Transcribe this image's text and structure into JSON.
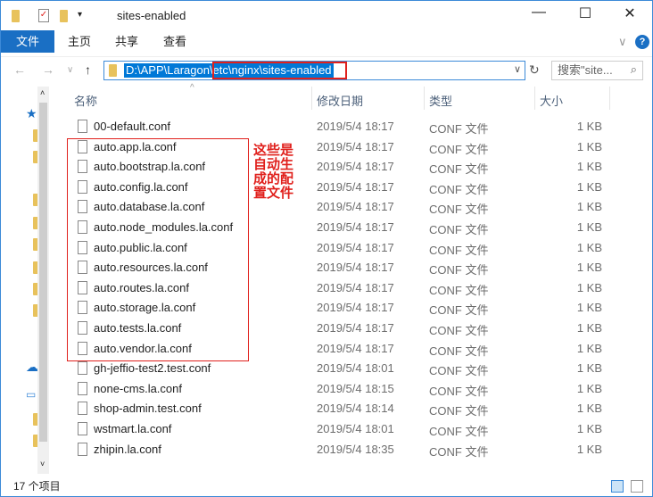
{
  "window": {
    "title": "sites-enabled",
    "minimize": "—",
    "maximize": "☐",
    "close": "✕"
  },
  "ribbon": {
    "tabs": [
      "文件",
      "主页",
      "共享",
      "查看"
    ],
    "help": "?",
    "collapse": "∨"
  },
  "nav": {
    "back": "←",
    "forward": "→",
    "recent": "∨",
    "up": "↑",
    "path": "D:\\APP\\Laragon\\etc\\nginx\\sites-enabled",
    "dropdown": "∨",
    "refresh": "↻",
    "search_placeholder": "搜索\"site...",
    "search_icon": "⌕"
  },
  "columns": {
    "name": "名称",
    "date": "修改日期",
    "type": "类型",
    "size": "大小",
    "sort_indicator": "^"
  },
  "files": [
    {
      "name": "00-default.conf",
      "date": "2019/5/4 18:17",
      "type": "CONF 文件",
      "size": "1 KB"
    },
    {
      "name": "auto.app.la.conf",
      "date": "2019/5/4 18:17",
      "type": "CONF 文件",
      "size": "1 KB"
    },
    {
      "name": "auto.bootstrap.la.conf",
      "date": "2019/5/4 18:17",
      "type": "CONF 文件",
      "size": "1 KB"
    },
    {
      "name": "auto.config.la.conf",
      "date": "2019/5/4 18:17",
      "type": "CONF 文件",
      "size": "1 KB"
    },
    {
      "name": "auto.database.la.conf",
      "date": "2019/5/4 18:17",
      "type": "CONF 文件",
      "size": "1 KB"
    },
    {
      "name": "auto.node_modules.la.conf",
      "date": "2019/5/4 18:17",
      "type": "CONF 文件",
      "size": "1 KB"
    },
    {
      "name": "auto.public.la.conf",
      "date": "2019/5/4 18:17",
      "type": "CONF 文件",
      "size": "1 KB"
    },
    {
      "name": "auto.resources.la.conf",
      "date": "2019/5/4 18:17",
      "type": "CONF 文件",
      "size": "1 KB"
    },
    {
      "name": "auto.routes.la.conf",
      "date": "2019/5/4 18:17",
      "type": "CONF 文件",
      "size": "1 KB"
    },
    {
      "name": "auto.storage.la.conf",
      "date": "2019/5/4 18:17",
      "type": "CONF 文件",
      "size": "1 KB"
    },
    {
      "name": "auto.tests.la.conf",
      "date": "2019/5/4 18:17",
      "type": "CONF 文件",
      "size": "1 KB"
    },
    {
      "name": "auto.vendor.la.conf",
      "date": "2019/5/4 18:17",
      "type": "CONF 文件",
      "size": "1 KB"
    },
    {
      "name": "gh-jeffio-test2.test.conf",
      "date": "2019/5/4 18:01",
      "type": "CONF 文件",
      "size": "1 KB"
    },
    {
      "name": "none-cms.la.conf",
      "date": "2019/5/4 18:15",
      "type": "CONF 文件",
      "size": "1 KB"
    },
    {
      "name": "shop-admin.test.conf",
      "date": "2019/5/4 18:14",
      "type": "CONF 文件",
      "size": "1 KB"
    },
    {
      "name": "wstmart.la.conf",
      "date": "2019/5/4 18:01",
      "type": "CONF 文件",
      "size": "1 KB"
    },
    {
      "name": "zhipin.la.conf",
      "date": "2019/5/4 18:35",
      "type": "CONF 文件",
      "size": "1 KB"
    }
  ],
  "annotation": "这些是自动生成的配置文件",
  "status": {
    "count": "17 个项目"
  },
  "colors": {
    "accent": "#0078d7",
    "annotation": "#e0201c"
  }
}
